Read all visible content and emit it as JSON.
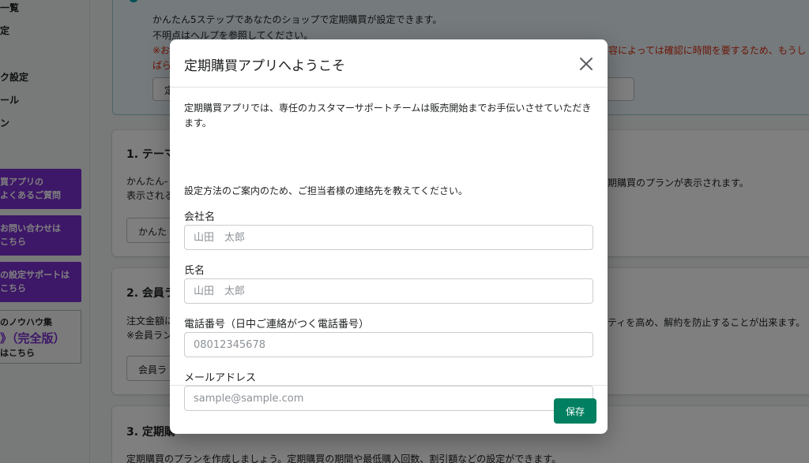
{
  "sidebar": {
    "items": [
      "一覧",
      "定",
      "ク設定",
      "ール",
      "ン"
    ],
    "promos": [
      {
        "line1": "買アプリの",
        "line2": "よくあるご質問"
      },
      {
        "line1": "お問い合わせは",
        "line2": "こちら"
      },
      {
        "line1": "の設定サポートは",
        "line2": "こちら"
      }
    ],
    "know_how": {
      "line1": "のノウハウ集",
      "line2": "》（完全版）",
      "line3": "はこちら"
    }
  },
  "banner": {
    "line1": "かんたん5ステップであなたのショップで定期購買が設定できます。",
    "line2": "不明点はヘルプを参照してください。",
    "line3_left": "※お",
    "line3_right": "容によっては確認に時間を要するため、もうし",
    "line4": "ばら",
    "button_partial": "定"
  },
  "cards": {
    "c1": {
      "title": "1. テーマ",
      "p1": "かんたん-",
      "p2": "表示される",
      "p_right": "期購買のプランが表示されます。",
      "button": "かんた"
    },
    "c2": {
      "title": "2. 会員ラ",
      "p1": "注文金額に",
      "p2": "※会員ラン",
      "p_right": "ティを高め、解約を防止することが出来ます。",
      "button": "会員ラ"
    },
    "c3": {
      "title": "3. 定期購",
      "p1": "定期購買のプランを作成しましょう。定期購買の期間や最低購入回数、割引額などの設定ができます。"
    }
  },
  "modal": {
    "title": "定期購買アプリへようこそ",
    "intro": "定期購買アプリでは、専任のカスタマーサポートチームは販売開始までお手伝いさせていただきます。",
    "intro2": "設定方法のご案内のため、ご担当者様の連絡先を教えてください。",
    "fields": {
      "company": {
        "label": "会社名",
        "placeholder": "山田　太郎",
        "value": ""
      },
      "name": {
        "label": "氏名",
        "placeholder": "山田　太郎",
        "value": ""
      },
      "phone": {
        "label": "電話番号（日中ご連絡がつく電話番号）",
        "placeholder": "08012345678",
        "value": ""
      },
      "email": {
        "label": "メールアドレス",
        "placeholder": "sample@sample.com",
        "value": ""
      }
    },
    "save_label": "保存"
  },
  "colors": {
    "primary": "#008060",
    "promo": "#7b2fd1",
    "error": "#d82c0d",
    "info_bg": "#ebf5fa"
  }
}
